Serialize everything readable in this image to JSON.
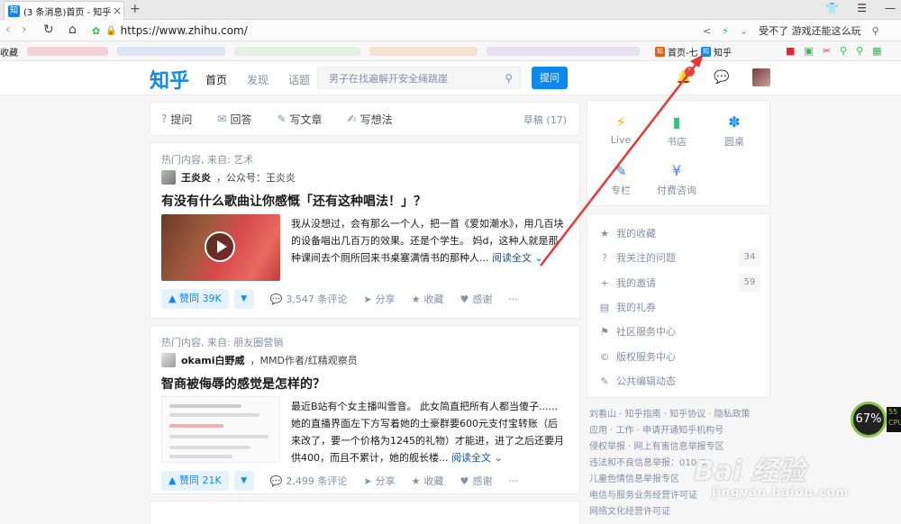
{
  "browser": {
    "tab_favicon": "知",
    "tab_title": "(3 条消息)首页 - 知乎",
    "url": "https://www.zhihu.com/",
    "address_right_text": "受不了 游戏还能这么玩",
    "bookmark_left": "收藏",
    "bookmarks": [
      {
        "label": "首页-七",
        "icon": "知",
        "color": "#e85c0d"
      },
      {
        "label": "知乎",
        "icon": "知",
        "color": "#0f88eb"
      }
    ]
  },
  "header": {
    "logo": "知乎",
    "nav": [
      "首页",
      "发现",
      "话题"
    ],
    "search_placeholder": "男子在找遍解开安全绳跳崖",
    "ask_label": "提问",
    "notification_count": "3"
  },
  "writebar": {
    "items": [
      {
        "icon": "?",
        "label": "提问"
      },
      {
        "icon": "✉",
        "label": "回答"
      },
      {
        "icon": "✎",
        "label": "写文章"
      },
      {
        "icon": "✍",
        "label": "写想法"
      }
    ],
    "drafts": "草稿 (17)"
  },
  "feed": [
    {
      "source": "热门内容, 来自: 艺术",
      "author": "王炎炎",
      "author_bio": "，公众号：王炎炎",
      "title": "有没有什么歌曲让你感慨「还有这种唱法！」？",
      "excerpt": "我从没想过，会有那么一个人，把一首《爱如潮水》，用几百块的设备唱出几百万的效果。还是个学生。 妈d，这种人就是那种课间去个厕所回来书桌塞满情书的那种人...",
      "read_more": "阅读全文 ⌄",
      "votes": "▲ 赞同 39K",
      "comments": "3,547 条评论",
      "share": "分享",
      "collect": "收藏",
      "thanks": "感谢",
      "more": "···"
    },
    {
      "source": "热门内容, 来自: 朋友圈营销",
      "author": "okami白野威",
      "author_bio": "，MMD作者/红精观察员",
      "title": "智商被侮辱的感觉是怎样的？",
      "excerpt": "最近B站有个女主播叫雪音。 此女简直把所有人都当傻子......她的直播界面左下方写着她的土豪群要600元支付宝转账（后来改了，要一个价格为1245的礼物）才能进，进了之后还要月供400，而且不累计，她的舰长楼...",
      "read_more": "阅读全文 ⌄",
      "votes": "▲ 赞同 21K",
      "comments": "2,499 条评论",
      "share": "分享",
      "collect": "收藏",
      "thanks": "感谢",
      "more": "···"
    }
  ],
  "quick_links": [
    {
      "label": "Live",
      "icon": "⚡",
      "color": "#f7b500"
    },
    {
      "label": "书店",
      "icon": "▮",
      "color": "#2ec87a"
    },
    {
      "label": "圆桌",
      "icon": "✽",
      "color": "#0f88eb"
    },
    {
      "label": "专栏",
      "icon": "✎",
      "color": "#0f88eb"
    },
    {
      "label": "付费咨询",
      "icon": "¥",
      "color": "#4e7fff"
    }
  ],
  "side_menu": [
    {
      "icon": "★",
      "label": "我的收藏",
      "count": ""
    },
    {
      "icon": "?",
      "label": "我关注的问题",
      "count": "34"
    },
    {
      "icon": "+",
      "label": "我的邀请",
      "count": "59"
    },
    {
      "icon": "▤",
      "label": "我的礼券",
      "count": ""
    },
    {
      "icon": "⚑",
      "label": "社区服务中心",
      "count": ""
    },
    {
      "icon": "©",
      "label": "版权服务中心",
      "count": ""
    },
    {
      "icon": "✎",
      "label": "公共编辑动态",
      "count": ""
    }
  ],
  "footer_lines": [
    "刘看山 · 知乎指南 · 知乎协议 · 隐私政策",
    "应用 · 工作 · 申请开通知乎机构号",
    "侵权举报 · 网上有害信息举报专区",
    "违法和不良信息举报：010-8",
    "儿童色情信息举报专区",
    "电信与服务业务经营许可证",
    "网络文化经营许可证"
  ],
  "overlays": {
    "cpu_percent": "67%",
    "cpu_side": "55",
    "cpu_label": "CPU",
    "watermark": "Bai 经验",
    "watermark_sub": "jingyan.baidu.com"
  }
}
